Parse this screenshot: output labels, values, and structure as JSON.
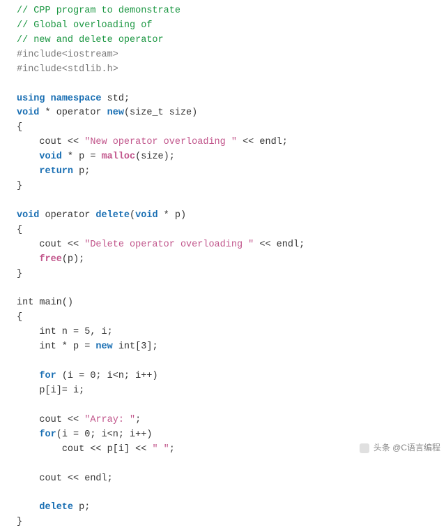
{
  "code": {
    "comment1": "// CPP program to demonstrate",
    "comment2": "// Global overloading of",
    "comment3": "// new and delete operator",
    "include1": "#include<iostream>",
    "include2": "#include<stdlib.h>",
    "kw_using": "using",
    "kw_namespace": "namespace",
    "ns_std": " std;",
    "kw_void": "void",
    "kw_operator": " operator ",
    "kw_new": "new",
    "sig_new_params": "(size_t size)",
    "brace_open": "{",
    "brace_close": "}",
    "indent": "    ",
    "cout_ll": "cout << ",
    "str_new": "\"New operator overloading \"",
    "endl_tail": " << endl;",
    "star_p_eq": " * p = ",
    "fn_malloc": "malloc",
    "malloc_args": "(size);",
    "kw_return": "return",
    "ret_p": " p;",
    "kw_delete": "delete",
    "sig_delete_params_open": "(",
    "sig_delete_params_mid": " * p)",
    "str_delete": "\"Delete operator overloading \"",
    "fn_free": "free",
    "free_args": "(p);",
    "int_main": "int main()",
    "int_decl": "int n = 5, i;",
    "int_ptr_decl_pre": "int * p = ",
    "new_int3": " int[3];",
    "kw_for": "for",
    "for1_cond": " (i = 0; i<n; i++)",
    "for_body1": "p[i]= i;",
    "str_array": "\"Array: \"",
    "semicolon": ";",
    "for2_cond": "(i = 0; i<n; i++)",
    "cout_pi": "cout << p[i] << ",
    "str_space": "\" \"",
    "cout_endl": "cout << endl;",
    "delete_p": " p;"
  },
  "watermark": {
    "text": "头条 @C语言编程"
  }
}
